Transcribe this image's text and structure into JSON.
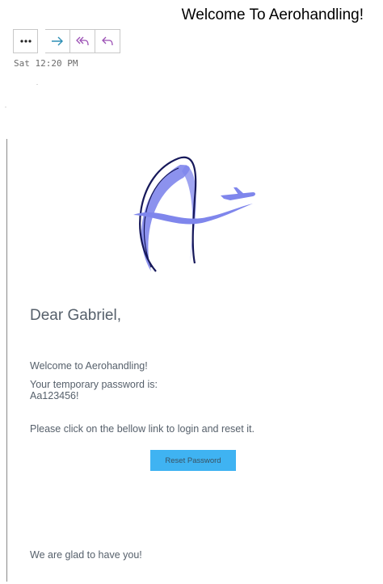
{
  "email": {
    "subject": "Welcome To Aerohandling!",
    "received_time": "Sat 12:20 PM"
  },
  "toolbar": {
    "more_icon": "more-ellipsis-icon",
    "forward_icon": "forward-arrow-icon",
    "reply_all_icon": "reply-all-icon",
    "reply_icon": "reply-icon"
  },
  "message": {
    "greeting": "Dear Gabriel,",
    "welcome_line": "Welcome to Aerohandling!",
    "password_label": "Your temporary password is:",
    "password_value": "Aa123456!",
    "instruction": "Please click on the bellow link to login and reset it.",
    "reset_button_label": "Reset Password",
    "closing": "We are glad to have you!"
  },
  "colors": {
    "forward_icon": "#2e8fb5",
    "reply_icons": "#9b4fb4",
    "logo_blue": "#7f86ec",
    "logo_outline": "#16185a",
    "button_bg": "#3fb3f2",
    "body_text": "#56606b"
  }
}
